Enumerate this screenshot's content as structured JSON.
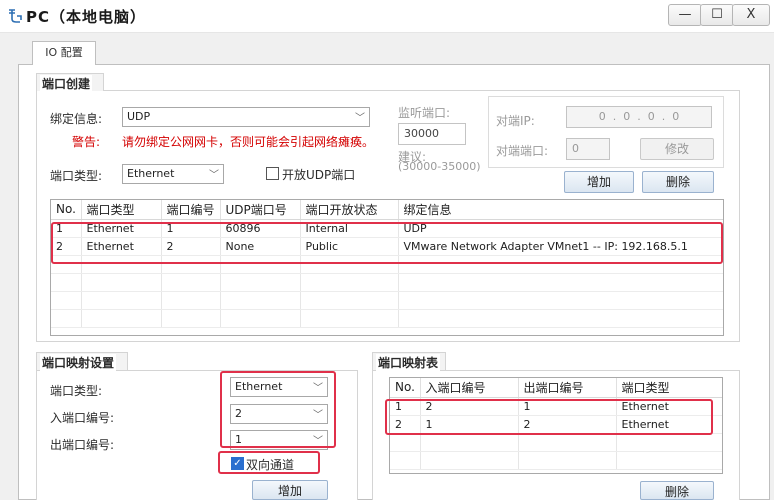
{
  "window": {
    "title": "PC（本地电脑）",
    "min_glyph": "—",
    "max_glyph": "☐",
    "close_glyph": "X"
  },
  "tabs": [
    {
      "label": "IO 配置",
      "active": true
    }
  ],
  "port_create": {
    "title": "端口创建",
    "bind_label": "绑定信息:",
    "bind_value": "UDP",
    "warning_label": "警告:",
    "warning_text": "请勿绑定公网网卡，否则可能会引起网络瘫痪。",
    "listen_label": "监听端口:",
    "listen_value": "30000",
    "suggest_label": "建议:",
    "suggest_range": "(30000-35000)",
    "peer_ip_label": "对端IP:",
    "peer_ip_value": "0  .  0  .  0  .  0",
    "peer_port_label": "对端端口:",
    "peer_port_value": "0",
    "modify_button": "修改",
    "port_type_label": "端口类型:",
    "port_type_value": "Ethernet",
    "open_udp_label": "开放UDP端口",
    "add_button": "增加",
    "delete_button": "删除",
    "table": {
      "headers": [
        "No.",
        "端口类型",
        "端口编号",
        "UDP端口号",
        "端口开放状态",
        "绑定信息"
      ],
      "rows": [
        [
          "1",
          "Ethernet",
          "1",
          "60896",
          "Internal",
          "UDP"
        ],
        [
          "2",
          "Ethernet",
          "2",
          "None",
          "Public",
          "VMware Network Adapter VMnet1 -- IP: 192.168.5.1"
        ]
      ]
    }
  },
  "port_mapping_settings": {
    "title": "端口映射设置",
    "port_type_label": "端口类型:",
    "port_type_value": "Ethernet",
    "in_port_label": "入端口编号:",
    "in_port_value": "2",
    "out_port_label": "出端口编号:",
    "out_port_value": "1",
    "bidirectional_label": "双向通道",
    "bidirectional_checked": true,
    "add_button": "增加"
  },
  "port_mapping_table": {
    "title": "端口映射表",
    "headers": [
      "No.",
      "入端口编号",
      "出端口编号",
      "端口类型"
    ],
    "rows": [
      [
        "1",
        "2",
        "1",
        "Ethernet"
      ],
      [
        "2",
        "1",
        "2",
        "Ethernet"
      ]
    ],
    "delete_button": "删除"
  },
  "colors": {
    "highlight": "#e0304a",
    "warning": "#d40000",
    "checkbox_accent": "#2a6fcf"
  },
  "icons": {
    "app": "network-plug-icon",
    "dropdown": "chevron-down-icon"
  }
}
